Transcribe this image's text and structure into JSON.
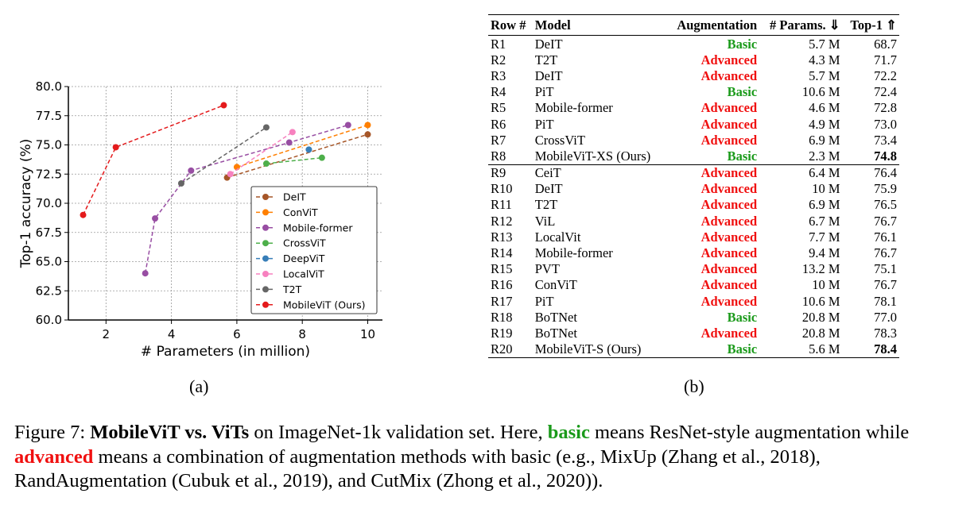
{
  "chart_data": {
    "type": "line",
    "xlabel": "# Parameters (in million)",
    "ylabel": "Top-1 accuracy (%)",
    "xlim": [
      0.85,
      10.45
    ],
    "ylim": [
      60,
      80
    ],
    "xticks": [
      2,
      4,
      6,
      8,
      10
    ],
    "yticks": [
      60.0,
      62.5,
      65.0,
      67.5,
      70.0,
      72.5,
      75.0,
      77.5,
      80.0
    ],
    "grid": true,
    "legend_placement": "lower-right",
    "line_style": "dashed",
    "markers": "circle",
    "series": [
      {
        "name": "DeIT",
        "color": "#a65628",
        "x": [
          5.7,
          10
        ],
        "y": [
          72.2,
          75.9
        ]
      },
      {
        "name": "ConViT",
        "color": "#ff7f00",
        "x": [
          6.0,
          10
        ],
        "y": [
          73.1,
          76.7
        ]
      },
      {
        "name": "Mobile-former",
        "color": "#984ea3",
        "x": [
          3.2,
          3.5,
          4.6,
          7.6,
          9.4
        ],
        "y": [
          64.0,
          68.7,
          72.8,
          75.2,
          76.7
        ]
      },
      {
        "name": "CrossViT",
        "color": "#4daf4a",
        "x": [
          6.9,
          8.6
        ],
        "y": [
          73.4,
          73.9
        ]
      },
      {
        "name": "DeepViT",
        "color": "#377eb8",
        "x": [
          8.2
        ],
        "y": [
          74.6
        ]
      },
      {
        "name": "LocalViT",
        "color": "#f781bf",
        "x": [
          5.8,
          7.7
        ],
        "y": [
          72.5,
          76.1
        ]
      },
      {
        "name": "T2T",
        "color": "#666666",
        "x": [
          4.3,
          6.9
        ],
        "y": [
          71.7,
          76.5
        ]
      },
      {
        "name": "MobileViT (Ours)",
        "color": "#e41a1c",
        "x": [
          1.3,
          2.3,
          5.6
        ],
        "y": [
          69.0,
          74.8,
          78.4
        ]
      }
    ]
  },
  "labels": {
    "a": "(a)",
    "b": "(b)"
  },
  "table": {
    "headers": [
      "Row #",
      "Model",
      "Augmentation",
      "# Params. ⇓",
      "Top-1 ⇑"
    ],
    "rows": [
      [
        "R1",
        "DeIT",
        "Basic",
        "5.7 M",
        "68.7"
      ],
      [
        "R2",
        "T2T",
        "Advanced",
        "4.3 M",
        "71.7"
      ],
      [
        "R3",
        "DeIT",
        "Advanced",
        "5.7 M",
        "72.2"
      ],
      [
        "R4",
        "PiT",
        "Basic",
        "10.6 M",
        "72.4"
      ],
      [
        "R5",
        "Mobile-former",
        "Advanced",
        "4.6 M",
        "72.8"
      ],
      [
        "R6",
        "PiT",
        "Advanced",
        "4.9 M",
        "73.0"
      ],
      [
        "R7",
        "CrossViT",
        "Advanced",
        "6.9 M",
        "73.4"
      ],
      [
        "R8",
        "MobileViT-XS (Ours)",
        "Basic",
        "2.3 M",
        "74.8"
      ],
      [
        "R9",
        "CeiT",
        "Advanced",
        "6.4 M",
        "76.4"
      ],
      [
        "R10",
        "DeIT",
        "Advanced",
        "10 M",
        "75.9"
      ],
      [
        "R11",
        "T2T",
        "Advanced",
        "6.9 M",
        "76.5"
      ],
      [
        "R12",
        "ViL",
        "Advanced",
        "6.7 M",
        "76.7"
      ],
      [
        "R13",
        "LocalVit",
        "Advanced",
        "7.7 M",
        "76.1"
      ],
      [
        "R14",
        "Mobile-former",
        "Advanced",
        "9.4 M",
        "76.7"
      ],
      [
        "R15",
        "PVT",
        "Advanced",
        "13.2 M",
        "75.1"
      ],
      [
        "R16",
        "ConViT",
        "Advanced",
        "10 M",
        "76.7"
      ],
      [
        "R17",
        "PiT",
        "Advanced",
        "10.6 M",
        "78.1"
      ],
      [
        "R18",
        "BoTNet",
        "Basic",
        "20.8 M",
        "77.0"
      ],
      [
        "R19",
        "BoTNet",
        "Advanced",
        "20.8 M",
        "78.3"
      ],
      [
        "R20",
        "MobileViT-S (Ours)",
        "Basic",
        "5.6 M",
        "78.4"
      ]
    ],
    "bold_rows": [
      "R8",
      "R20"
    ]
  },
  "caption": {
    "prefix": "Figure 7: ",
    "bold_title": "MobileViT vs. ViTs",
    "t1": " on ImageNet-1k validation set. Here, ",
    "basic": "basic",
    "t2": " means ResNet-style augmentation while ",
    "advanced": "advanced",
    "t3": " means a combination of augmentation methods with basic (e.g., MixUp (Zhang et al., 2018), RandAugmentation (Cubuk et al., 2019), and CutMix (Zhong et al., 2020))."
  }
}
